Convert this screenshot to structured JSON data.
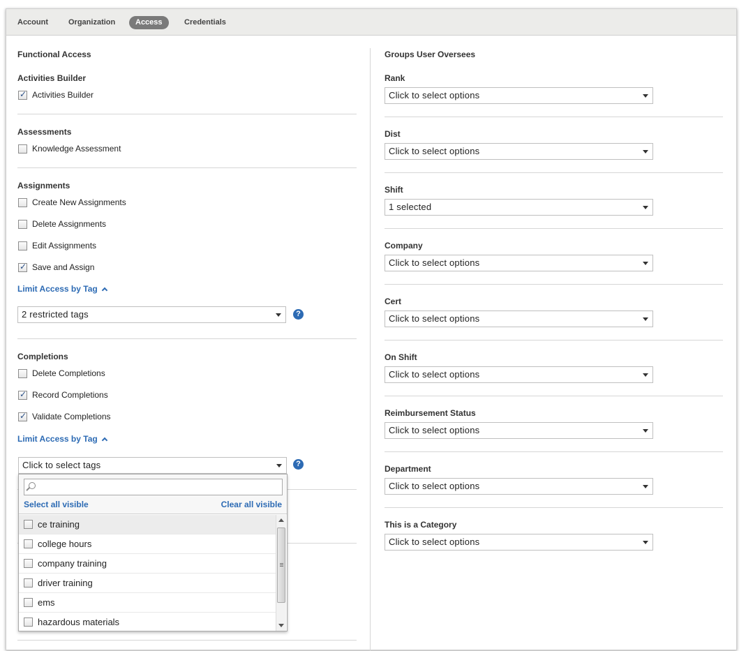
{
  "tabs": [
    "Account",
    "Organization",
    "Access",
    "Credentials"
  ],
  "active_tab": "Access",
  "left": {
    "heading": "Functional Access",
    "activities_builder": {
      "title": "Activities Builder",
      "items": [
        {
          "label": "Activities Builder",
          "checked": true
        }
      ]
    },
    "assessments": {
      "title": "Assessments",
      "items": [
        {
          "label": "Knowledge Assessment",
          "checked": false
        }
      ]
    },
    "assignments": {
      "title": "Assignments",
      "items": [
        {
          "label": "Create New Assignments",
          "checked": false
        },
        {
          "label": "Delete Assignments",
          "checked": false
        },
        {
          "label": "Edit Assignments",
          "checked": false
        },
        {
          "label": "Save and Assign",
          "checked": true
        }
      ],
      "limit_link": "Limit Access by Tag",
      "tag_select": "2 restricted tags",
      "help": "?"
    },
    "completions": {
      "title": "Completions",
      "items": [
        {
          "label": "Delete Completions",
          "checked": false
        },
        {
          "label": "Record Completions",
          "checked": true
        },
        {
          "label": "Validate Completions",
          "checked": true
        }
      ],
      "limit_link": "Limit Access by Tag",
      "tag_select": "Click to select tags",
      "help": "?"
    },
    "tag_dropdown": {
      "search_value": "",
      "select_all": "Select all visible",
      "clear_all": "Clear all visible",
      "options": [
        "ce training",
        "college hours",
        "company training",
        "driver training",
        "ems",
        "hazardous materials"
      ]
    }
  },
  "right": {
    "heading": "Groups User Oversees",
    "groups": [
      {
        "label": "Rank",
        "value": "Click to select options"
      },
      {
        "label": "Dist",
        "value": "Click to select options"
      },
      {
        "label": "Shift",
        "value": "1 selected"
      },
      {
        "label": "Company",
        "value": "Click to select options"
      },
      {
        "label": "Cert",
        "value": "Click to select options"
      },
      {
        "label": "On Shift",
        "value": "Click to select options"
      },
      {
        "label": "Reimbursement Status",
        "value": "Click to select options"
      },
      {
        "label": "Department",
        "value": "Click to select options"
      },
      {
        "label": "This is a Category",
        "value": "Click to select options"
      }
    ]
  }
}
